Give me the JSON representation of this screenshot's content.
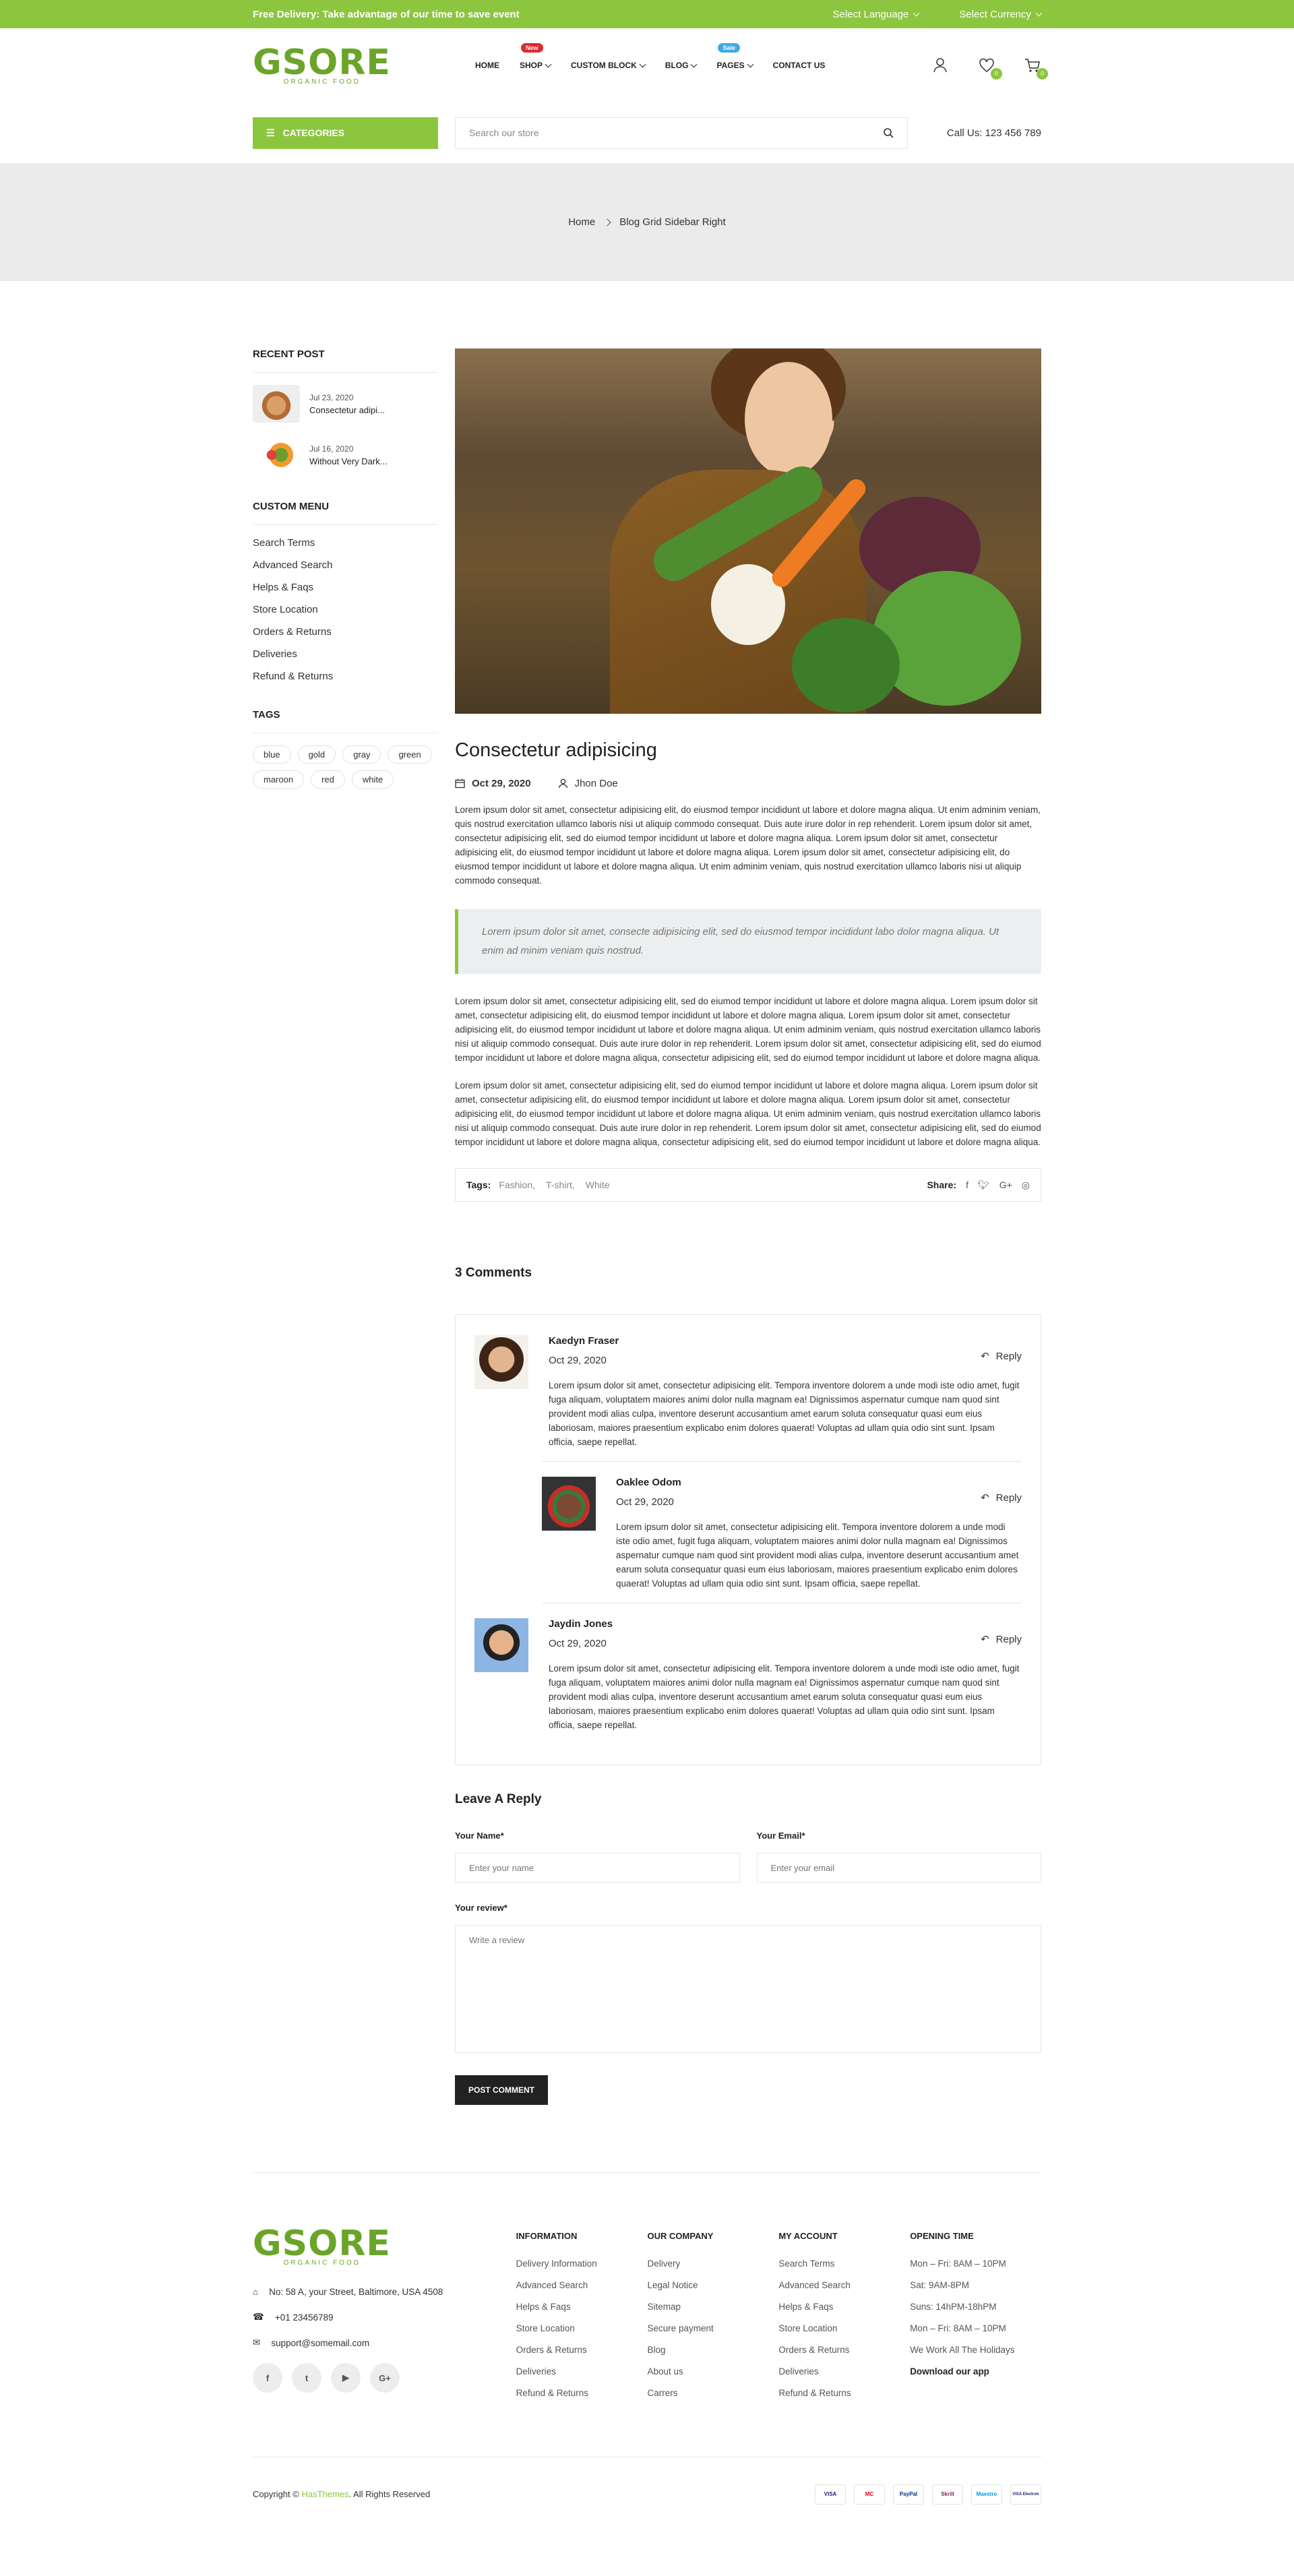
{
  "topbar": {
    "promo": "Free Delivery: Take advantage of our time to save event",
    "language": "Select Language",
    "currency": "Select Currency"
  },
  "logo": {
    "text": "GSORE",
    "tagline": "ORGANIC FOOD"
  },
  "nav": [
    {
      "label": "HOME",
      "dropdown": false,
      "badge": ""
    },
    {
      "label": "SHOP",
      "dropdown": true,
      "badge": "New"
    },
    {
      "label": "CUSTOM BLOCK",
      "dropdown": true,
      "badge": ""
    },
    {
      "label": "BLOG",
      "dropdown": true,
      "badge": ""
    },
    {
      "label": "PAGES",
      "dropdown": true,
      "badge": "Sale"
    },
    {
      "label": "CONTACT US",
      "dropdown": false,
      "badge": ""
    }
  ],
  "header_icons": {
    "wishlist_count": "0",
    "cart_count": "0"
  },
  "catbar": {
    "categories": "CATEGORIES",
    "search_placeholder": "Search our store",
    "call": "Call Us: 123 456 789"
  },
  "breadcrumb": {
    "home": "Home",
    "current": "Blog Grid Sidebar Right"
  },
  "sidebar": {
    "recent_title": "RECENT POST",
    "recent": [
      {
        "date": "Jul 23, 2020",
        "title": "Consectetur adipi..."
      },
      {
        "date": "Jul 16, 2020",
        "title": "Without Very Dark..."
      }
    ],
    "menu_title": "CUSTOM MENU",
    "menu": [
      "Search Terms",
      "Advanced Search",
      "Helps & Faqs",
      "Store Location",
      "Orders & Returns",
      "Deliveries",
      "Refund & Returns"
    ],
    "tags_title": "TAGS",
    "tags": [
      "blue",
      "gold",
      "gray",
      "green",
      "maroon",
      "red",
      "white"
    ]
  },
  "post": {
    "title": "Consectetur adipisicing",
    "date": "Oct 29, 2020",
    "author": "Jhon Doe",
    "p1": "Lorem ipsum dolor sit amet, consectetur adipisicing elit, do eiusmod tempor incididunt ut labore et dolore magna aliqua. Ut enim adminim veniam, quis nostrud exercitation ullamco laboris nisi ut aliquip commodo consequat. Duis aute irure dolor in rep rehenderit. Lorem ipsum dolor sit amet, consectetur adipisicing elit, sed do eiumod tempor incididunt ut labore et dolore magna aliqua. Lorem ipsum dolor sit amet, consectetur adipisicing elit, do eiusmod tempor incididunt ut labore et dolore magna aliqua. Lorem ipsum dolor sit amet, consectetur adipisicing elit, do eiusmod tempor incididunt ut labore et dolore magna aliqua. Ut enim adminim veniam, quis nostrud exercitation ullamco laboris nisi ut aliquip commodo consequat.",
    "quote": "Lorem ipsum dolor sit amet, consecte adipisicing elit, sed do eiusmod tempor incididunt labo dolor magna aliqua. Ut enim ad minim veniam quis nostrud.",
    "p2": "Lorem ipsum dolor sit amet, consectetur adipisicing elit, sed do eiumod tempor incididunt ut labore et dolore magna aliqua. Lorem ipsum dolor sit amet, consectetur adipisicing elit, do eiusmod tempor incididunt ut labore et dolore magna aliqua. Lorem ipsum dolor sit amet, consectetur adipisicing elit, do eiusmod tempor incididunt ut labore et dolore magna aliqua. Ut enim adminim veniam, quis nostrud exercitation ullamco laboris nisi ut aliquip commodo consequat. Duis aute irure dolor in rep rehenderit. Lorem ipsum dolor sit amet, consectetur adipisicing elit, sed do eiumod tempor incididunt ut labore et dolore magna aliqua, consectetur adipisicing elit, sed do eiumod tempor incididunt ut labore et dolore magna aliqua.",
    "p3": "Lorem ipsum dolor sit amet, consectetur adipisicing elit, sed do eiumod tempor incididunt ut labore et dolore magna aliqua. Lorem ipsum dolor sit amet, consectetur adipisicing elit, do eiusmod tempor incididunt ut labore et dolore magna aliqua. Lorem ipsum dolor sit amet, consectetur adipisicing elit, do eiusmod tempor incididunt ut labore et dolore magna aliqua. Ut enim adminim veniam, quis nostrud exercitation ullamco laboris nisi ut aliquip commodo consequat. Duis aute irure dolor in rep rehenderit. Lorem ipsum dolor sit amet, consectetur adipisicing elit, sed do eiumod tempor incididunt ut labore et dolore magna aliqua, consectetur adipisicing elit, sed do eiumod tempor incididunt ut labore et dolore magna aliqua.",
    "tags_label": "Tags:",
    "tags": [
      "Fashion,",
      "T-shirt,",
      "White"
    ],
    "share_label": "Share:",
    "share_icons": [
      "facebook-icon",
      "twitter-icon",
      "google-plus-icon",
      "instagram-icon"
    ]
  },
  "comments": {
    "title": "3 Comments",
    "reply_label": "Reply",
    "items": [
      {
        "name": "Kaedyn Fraser",
        "date": "Oct 29, 2020",
        "text": "Lorem ipsum dolor sit amet, consectetur adipisicing elit. Tempora inventore dolorem a unde modi iste odio amet, fugit fuga aliquam, voluptatem maiores animi dolor nulla magnam ea! Dignissimos aspernatur cumque nam quod sint provident modi alias culpa, inventore deserunt accusantium amet earum soluta consequatur quasi eum eius laboriosam, maiores praesentium explicabo enim dolores quaerat! Voluptas ad ullam quia odio sint sunt. Ipsam officia, saepe repellat."
      },
      {
        "name": "Oaklee Odom",
        "date": "Oct 29, 2020",
        "text": "Lorem ipsum dolor sit amet, consectetur adipisicing elit. Tempora inventore dolorem a unde modi iste odio amet, fugit fuga aliquam, voluptatem maiores animi dolor nulla magnam ea! Dignissimos aspernatur cumque nam quod sint provident modi alias culpa, inventore deserunt accusantium amet earum soluta consequatur quasi eum eius laboriosam, maiores praesentium explicabo enim dolores quaerat! Voluptas ad ullam quia odio sint sunt. Ipsam officia, saepe repellat."
      },
      {
        "name": "Jaydin Jones",
        "date": "Oct 29, 2020",
        "text": "Lorem ipsum dolor sit amet, consectetur adipisicing elit. Tempora inventore dolorem a unde modi iste odio amet, fugit fuga aliquam, voluptatem maiores animi dolor nulla magnam ea! Dignissimos aspernatur cumque nam quod sint provident modi alias culpa, inventore deserunt accusantium amet earum soluta consequatur quasi eum eius laboriosam, maiores praesentium explicabo enim dolores quaerat! Voluptas ad ullam quia odio sint sunt. Ipsam officia, saepe repellat."
      }
    ]
  },
  "form": {
    "title": "Leave A Reply",
    "name_label": "Your Name*",
    "name_placeholder": "Enter your name",
    "email_label": "Your Email*",
    "email_placeholder": "Enter your email",
    "review_label": "Your review*",
    "review_placeholder": "Write a review",
    "submit": "POST COMMENT"
  },
  "footer": {
    "address": "No: 58 A, your Street, Baltimore, USA 4508",
    "phone": "+01 23456789",
    "email": "support@somemail.com",
    "socials": [
      "f",
      "t",
      "▶",
      "G+"
    ],
    "columns": [
      {
        "title": "INFORMATION",
        "items": [
          "Delivery Information",
          "Advanced Search",
          "Helps & Faqs",
          "Store Location",
          "Orders & Returns",
          "Deliveries",
          "Refund & Returns"
        ]
      },
      {
        "title": "OUR COMPANY",
        "items": [
          "Delivery",
          "Legal Notice",
          "Sitemap",
          "Secure payment",
          "Blog",
          "About us",
          "Carrers"
        ]
      },
      {
        "title": "MY ACCOUNT",
        "items": [
          "Search Terms",
          "Advanced Search",
          "Helps & Faqs",
          "Store Location",
          "Orders & Returns",
          "Deliveries",
          "Refund & Returns"
        ]
      },
      {
        "title": "OPENING TIME",
        "items": [
          "Mon – Fri: 8AM – 10PM",
          "Sat: 9AM-8PM",
          "Suns: 14hPM-18hPM",
          "Mon – Fri: 8AM – 10PM",
          "We Work All The Holidays",
          "Download our app"
        ]
      }
    ],
    "copy_prefix": "Copyright ©",
    "copy_brand": "HasThemes",
    "copy_suffix": ". All Rights Reserved",
    "payments": [
      "VISA",
      "MC",
      "PayPal",
      "Skrill",
      "Maestro",
      "VISA Electron"
    ]
  },
  "colors": {
    "accent": "#8cc63f",
    "dark": "#222222"
  }
}
